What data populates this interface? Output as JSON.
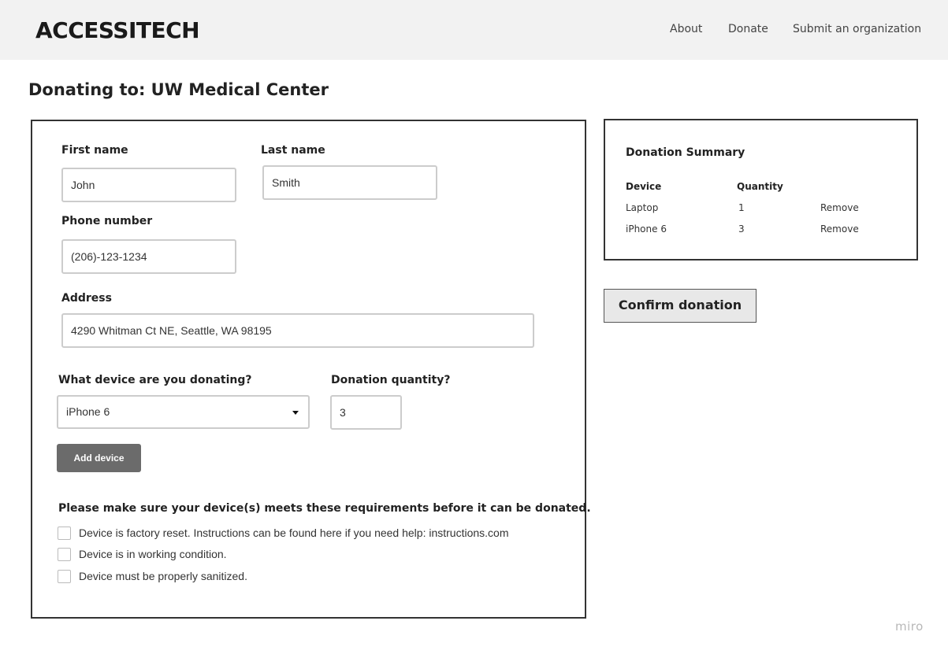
{
  "header": {
    "logo": "ACCESSITECH",
    "nav": [
      "About",
      "Donate",
      "Submit an organization"
    ]
  },
  "page": {
    "title": "Donating to: UW Medical Center"
  },
  "form": {
    "first_name": {
      "label": "First name",
      "value": "John"
    },
    "last_name": {
      "label": "Last name",
      "value": "Smith"
    },
    "phone": {
      "label": "Phone number",
      "value": "(206)-123-1234"
    },
    "address": {
      "label": "Address",
      "value": "4290 Whitman Ct NE, Seattle, WA 98195"
    },
    "device": {
      "label": "What device are you donating?",
      "selected": "iPhone 6"
    },
    "quantity": {
      "label": "Donation quantity?",
      "value": "3"
    },
    "add_button": "Add device",
    "requirements": {
      "title": "Please make sure your device(s) meets these requirements before it can be donated.",
      "items": [
        "Device is factory reset. Instructions can be found here if you need help: instructions.com",
        "Device is in working condition.",
        "Device must be properly sanitized."
      ]
    }
  },
  "summary": {
    "title": "Donation Summary",
    "headers": [
      "Device",
      "Quantity"
    ],
    "rows": [
      {
        "device": "Laptop",
        "quantity": "1",
        "action": "Remove"
      },
      {
        "device": "iPhone 6",
        "quantity": "3",
        "action": "Remove"
      }
    ]
  },
  "confirm_button": "Confirm donation",
  "watermark": "miro"
}
